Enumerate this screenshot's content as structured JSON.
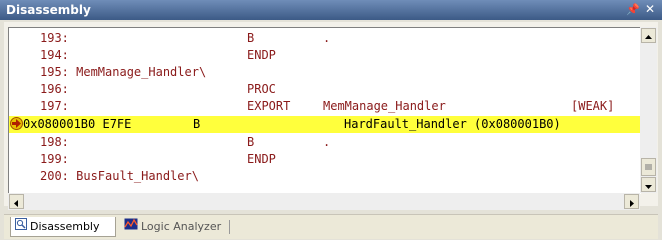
{
  "panel": {
    "title": "Disassembly",
    "pin_glyph": "%2",
    "close_glyph": "×"
  },
  "lines": [
    {
      "num": "193:",
      "op": "B",
      "arg": ".",
      "extra": ""
    },
    {
      "num": "194:",
      "op": "ENDP",
      "arg": "",
      "extra": ""
    },
    {
      "num": "195: MemManage_Handler\\",
      "op": "",
      "arg": "",
      "extra": ""
    },
    {
      "num": "196:",
      "op": "PROC",
      "arg": "",
      "extra": ""
    },
    {
      "num": "197:",
      "op": "EXPORT",
      "arg": "MemManage_Handler",
      "extra": "[WEAK]"
    },
    {
      "addr": "0x080001B0 E7FE",
      "op": "B",
      "arg": "HardFault_Handler (0x080001B0)"
    },
    {
      "num": "198:",
      "op": "B",
      "arg": ".",
      "extra": ""
    },
    {
      "num": "199:",
      "op": "ENDP",
      "arg": "",
      "extra": ""
    },
    {
      "num": "200: BusFault_Handler\\",
      "op": "",
      "arg": "",
      "extra": ""
    }
  ],
  "tabs": [
    {
      "label": "Disassembly",
      "icon": "disassembly-icon"
    },
    {
      "label": "Logic Analyzer",
      "icon": "logic-analyzer-icon"
    }
  ],
  "colors": {
    "highlight": "#ffff3c",
    "source_text": "#8a1a1a",
    "title_bar": "#3c5a86"
  }
}
